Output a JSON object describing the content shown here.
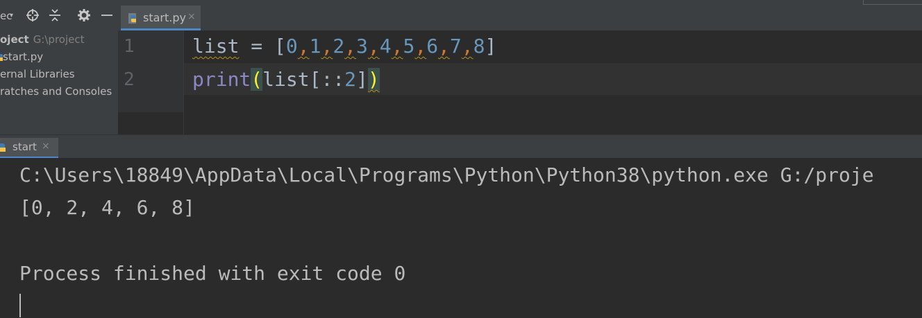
{
  "toolbar": {
    "project_label": "ec",
    "icons": [
      "dropdown-arrow-icon",
      "crosshair-icon",
      "collapse-icon",
      "gear-icon",
      "minimize-icon"
    ]
  },
  "editor_tabs": [
    {
      "label": "start.py",
      "close": "×",
      "icon": "python-file-icon",
      "active": true
    }
  ],
  "project_tree": {
    "root_label": "oject",
    "root_path": "G:\\project",
    "items": [
      {
        "label": "start.py",
        "icon": "python-file-icon"
      },
      {
        "label": "ernal Libraries"
      },
      {
        "label": "ratches and Consoles"
      }
    ]
  },
  "editor": {
    "line_numbers": [
      "1",
      "2"
    ],
    "lines": [
      {
        "list_kw": "list",
        "assign": " = [",
        "nums": [
          "0",
          "1",
          "2",
          "3",
          "4",
          "5",
          "6",
          "7",
          "8"
        ],
        "close": "]"
      },
      {
        "print": "print",
        "open_paren": "(",
        "middle": "list[::",
        "num": "2",
        "bracket": "]",
        "close_paren": ")"
      }
    ]
  },
  "run_panel": {
    "tab_label": "start",
    "tab_close": "×",
    "console_lines": [
      "C:\\Users\\18849\\AppData\\Local\\Programs\\Python\\Python38\\python.exe G:/proje",
      "[0, 2, 4, 6, 8]",
      "",
      "Process finished with exit code 0"
    ]
  },
  "colors": {
    "background": "#2b2b2b",
    "panel": "#3c3f41",
    "number": "#6897bb",
    "keyword": "#8888c6",
    "accent": "#4a88c7"
  }
}
